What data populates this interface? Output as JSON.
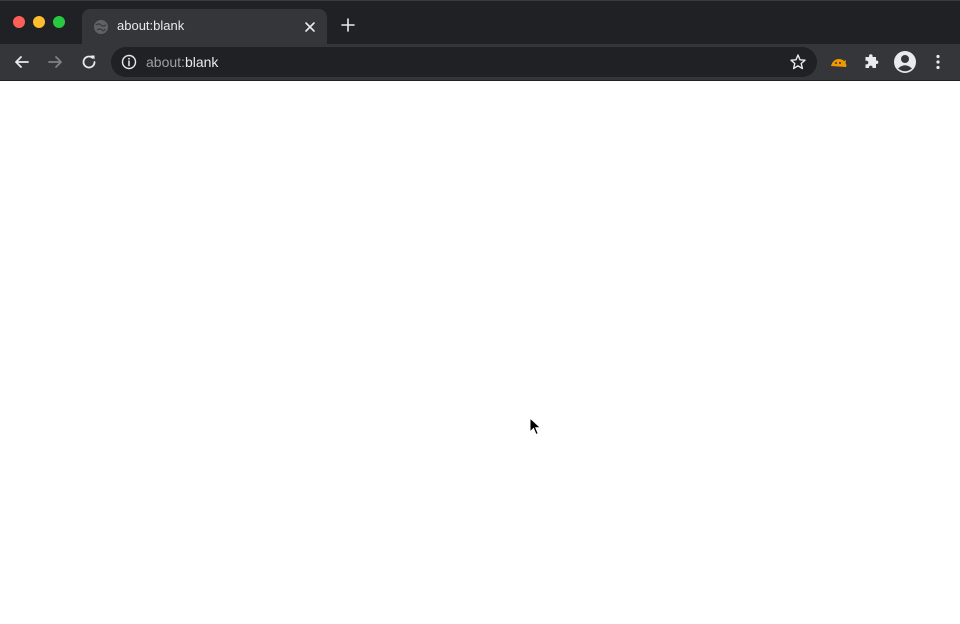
{
  "window": {
    "traffic_colors": {
      "close": "#ff5f57",
      "minimize": "#febc2e",
      "maximize": "#28c840"
    }
  },
  "tabs": [
    {
      "title": "about:blank",
      "favicon": "globe-icon",
      "active": true
    }
  ],
  "toolbar": {
    "omnibox": {
      "scheme": "about:",
      "host": "blank",
      "info_icon": "info-icon",
      "bookmark_icon": "star-icon"
    },
    "extensions": [
      "cat-extension-icon",
      "puzzle-icon"
    ],
    "profile_icon": "account-circle-icon",
    "menu_icon": "kebab-menu-icon"
  },
  "colors": {
    "tabstrip": "#202124",
    "toolbar": "#35363a",
    "omnibox": "#202124",
    "text": "#e8eaed",
    "muted": "#9aa0a6"
  }
}
